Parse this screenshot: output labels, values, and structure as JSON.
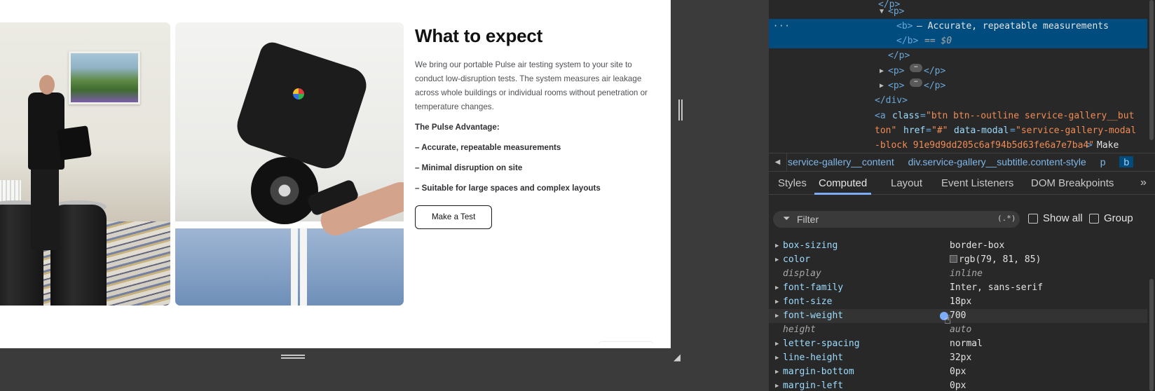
{
  "page": {
    "heading": "What to expect",
    "intro": "We bring our portable Pulse air testing system to your site to conduct low-disruption tests. The system measures air leakage across whole buildings or individual rooms without penetration or temperature changes.",
    "advantage_title": "The Pulse Advantage:",
    "points": [
      "– Accurate, repeatable measurements",
      "– Minimal disruption on site",
      "– Suitable for large spaces and complex layouts"
    ],
    "cta_label": "Make a Test"
  },
  "devtools": {
    "elements": {
      "line0_tag": "<p>",
      "selected_text": "– Accurate, repeatable measurements",
      "selected_close": "</b>",
      "selected_eq": "== $0",
      "close_p": "</p>",
      "p_open": "<p>",
      "p_close": "</p>",
      "close_div": "</div>",
      "a_tag_start": "<a",
      "a_attr_class": "class",
      "a_class_val_1": "\"btn btn--outline service-gallery__but",
      "a_class_val_2": "ton\"",
      "a_attr_href": "href",
      "a_href_val": "\"#\"",
      "a_attr_modal": "data-modal",
      "a_modal_val_1": "\"service-gallery-modal",
      "a_modal_val_2": "-block_91e9d9dd205c6af94b5d63fe6a7e7ba4\"",
      "a_text": "Make",
      "b_open": "<b>",
      "ellipsis": "⋯"
    },
    "breadcrumb": [
      "service-gallery__content",
      "div.service-gallery__subtitle.content-style",
      "p",
      "b"
    ],
    "tabs": [
      "Styles",
      "Computed",
      "Layout",
      "Event Listeners",
      "DOM Breakpoints"
    ],
    "active_tab": "Computed",
    "filter_placeholder": "Filter",
    "filter_regex": "(.*)",
    "show_all_label": "Show all",
    "group_label": "Group",
    "computed": [
      {
        "name": "box-sizing",
        "value": "border-box"
      },
      {
        "name": "color",
        "value": "rgb(79, 81, 85)"
      },
      {
        "name": "display",
        "value": "inline"
      },
      {
        "name": "font-family",
        "value": "Inter, sans-serif"
      },
      {
        "name": "font-size",
        "value": "18px"
      },
      {
        "name": "font-weight",
        "value": "700"
      },
      {
        "name": "height",
        "value": "auto"
      },
      {
        "name": "letter-spacing",
        "value": "normal"
      },
      {
        "name": "line-height",
        "value": "32px"
      },
      {
        "name": "margin-bottom",
        "value": "0px"
      },
      {
        "name": "margin-left",
        "value": "0px"
      }
    ],
    "color_swatch": "#4f5155"
  }
}
